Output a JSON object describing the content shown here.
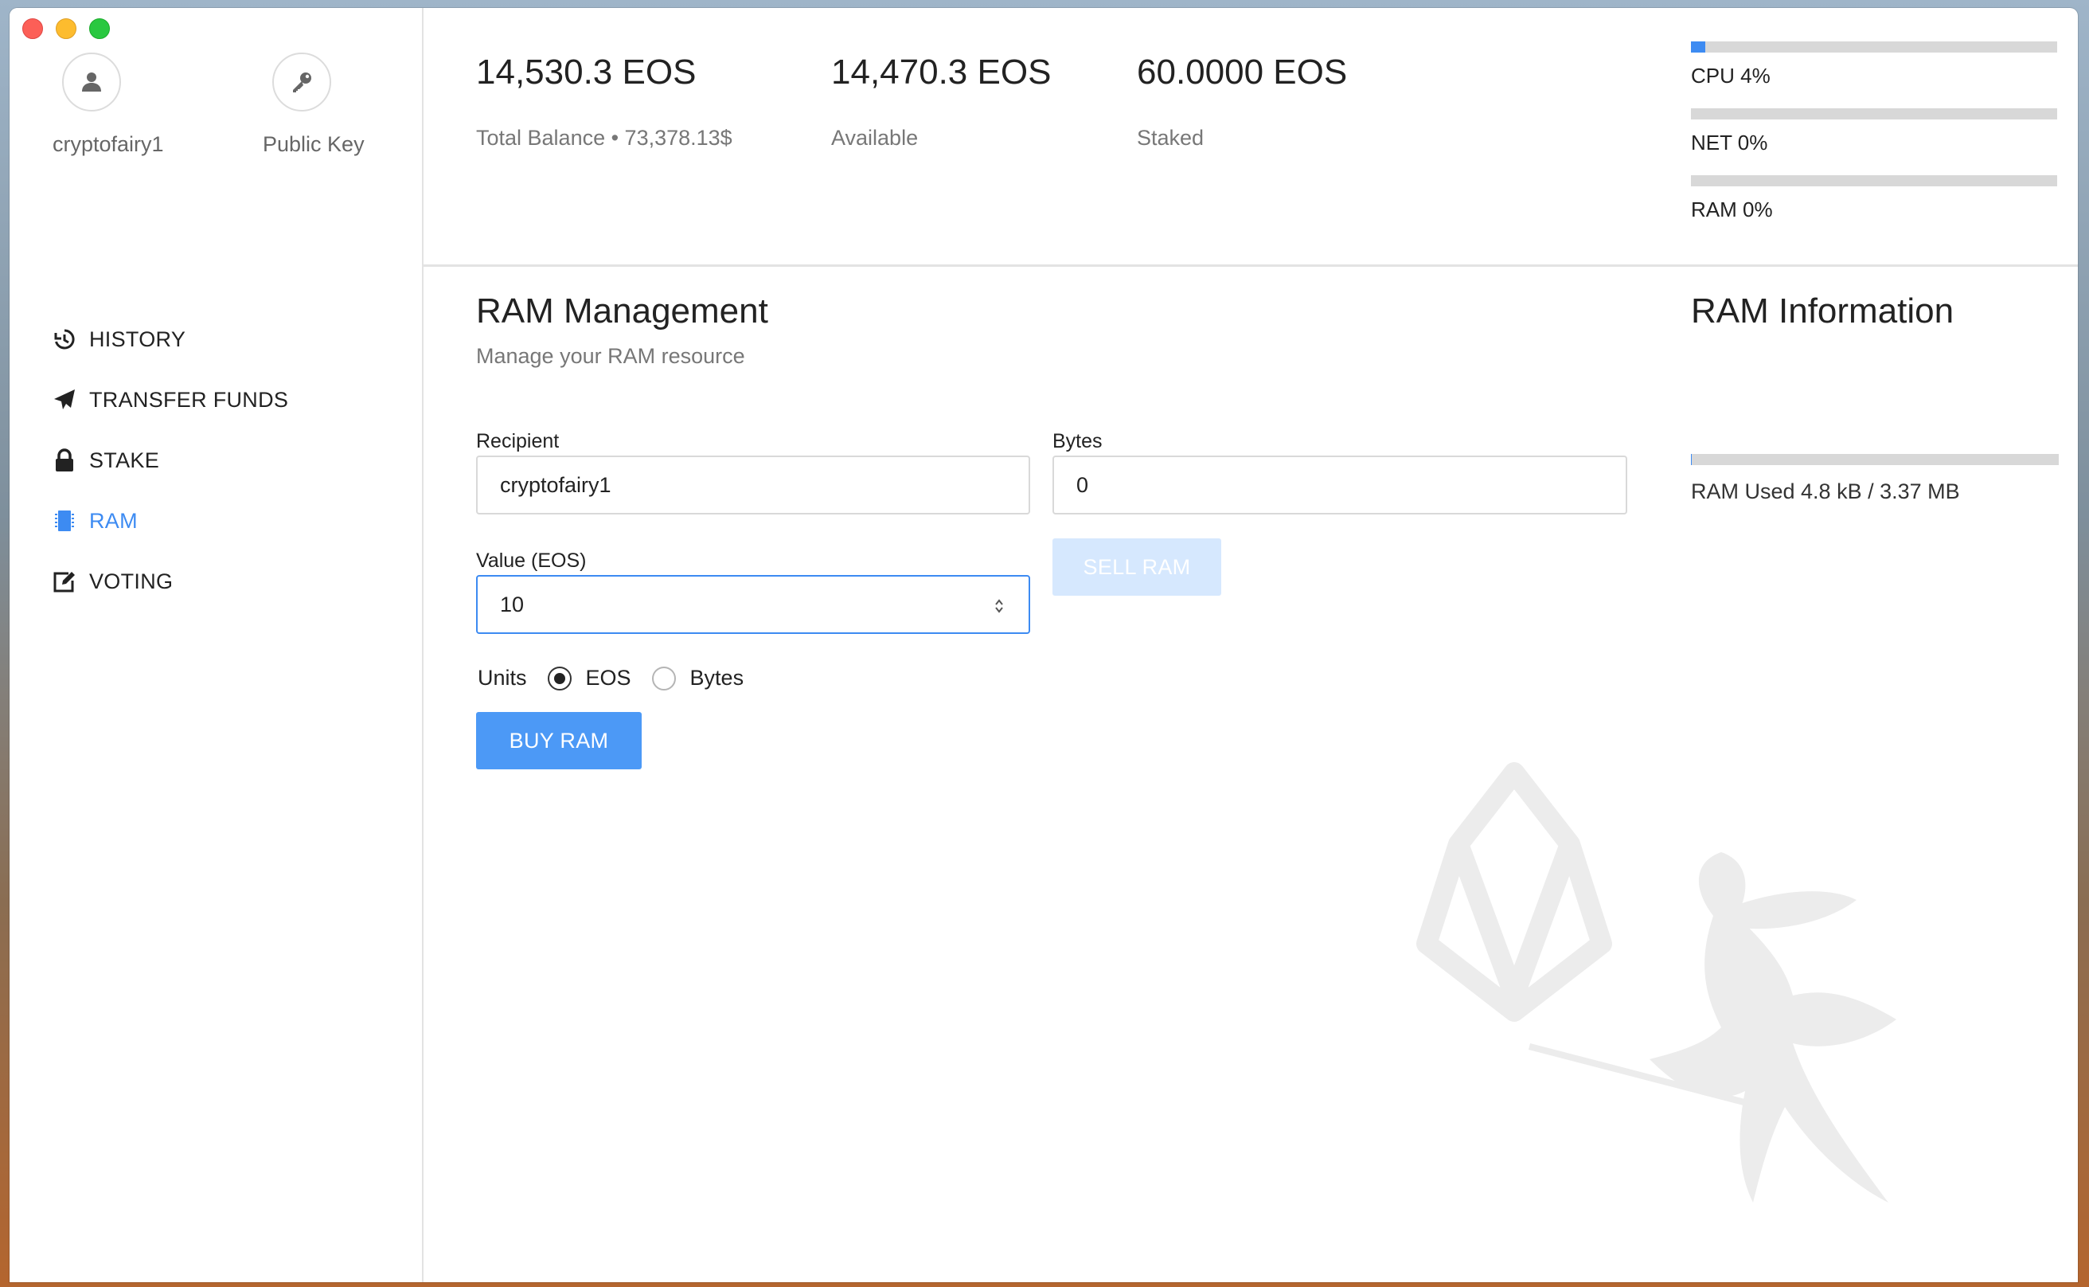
{
  "account": {
    "username": "cryptofairy1",
    "public_key_label": "Public Key"
  },
  "nav": {
    "items": [
      {
        "label": "HISTORY",
        "icon": "history-icon"
      },
      {
        "label": "TRANSFER FUNDS",
        "icon": "paper-plane-icon"
      },
      {
        "label": "STAKE",
        "icon": "lock-icon"
      },
      {
        "label": "RAM",
        "icon": "memory-chip-icon"
      },
      {
        "label": "VOTING",
        "icon": "edit-icon"
      }
    ],
    "active": "RAM"
  },
  "balances": {
    "total": {
      "value": "14,530.3 EOS",
      "label": "Total Balance • 73,378.13$"
    },
    "available": {
      "value": "14,470.3 EOS",
      "label": "Available"
    },
    "staked": {
      "value": "60.0000 EOS",
      "label": "Staked"
    }
  },
  "resources": [
    {
      "label": "CPU 4%",
      "percent": 4
    },
    {
      "label": "NET 0%",
      "percent": 0
    },
    {
      "label": "RAM 0%",
      "percent": 0
    }
  ],
  "ram_management": {
    "title": "RAM Management",
    "subtitle": "Manage your RAM resource",
    "recipient_label": "Recipient",
    "recipient_value": "cryptofairy1",
    "bytes_label": "Bytes",
    "bytes_value": "0",
    "value_label": "Value (EOS)",
    "value_value": "10",
    "units_label": "Units",
    "unit_options": [
      "EOS",
      "Bytes"
    ],
    "selected_unit": "EOS",
    "sell_button": "SELL RAM",
    "buy_button": "BUY RAM"
  },
  "ram_information": {
    "title": "RAM Information",
    "used_label": "RAM Used 4.8 kB / 3.37 MB",
    "used_fraction": 0.0014
  },
  "colors": {
    "accent": "#3d8bf2",
    "button": "#4c99f6",
    "button_disabled": "#d6e8fe"
  }
}
